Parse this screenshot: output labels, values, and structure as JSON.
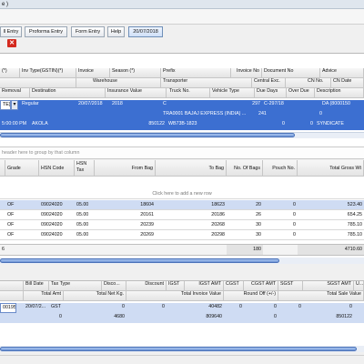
{
  "window": {
    "title": "e )"
  },
  "toolbar": {
    "buttons": [
      "ll Entry",
      "Proforma Entry",
      "Form Entry",
      "Help",
      "20/07/2018"
    ],
    "close_glyph": "✕"
  },
  "top_grid": {
    "header_row1": [
      "(*)",
      "Inv Type(GSTIN)(*)",
      "Invoice",
      "Season (*)",
      "Prefix",
      "Invoice No",
      "Document No",
      "Advice"
    ],
    "header_row2": [
      "Warehouse",
      "Transporter",
      "Central Exc.",
      "CN No.",
      "CN Date"
    ],
    "header_row3": [
      "Removal",
      "Destination",
      "Insurance Value",
      "Truck No.",
      "Vehicle Type",
      "Due Days",
      "Over Due",
      "Description"
    ],
    "row1": {
      "c0": "TE)",
      "dropdown": "▾",
      "regular": "Regular",
      "date": "20/07/2018",
      "year": "2018",
      "c": "C",
      "n297": "297",
      "cno": "C-297/18",
      "da": "DA (8000150"
    },
    "row2": {
      "transporter": "TRA0001 BAJAJ EXPRESS (INDIA) ...",
      "n241": "241",
      "val": "0"
    },
    "row3": {
      "time": "5:00:00 PM",
      "dest": "AKOLA",
      "ins": "850122",
      "truck": "WB73B-1823",
      "d1": "0",
      "d2": "0",
      "desc": "SYNDICATE"
    }
  },
  "group_hint": "header here to group by that column",
  "item_grid": {
    "headers": [
      "Grade",
      "HSN Code",
      "HSN Tax",
      "From Bag",
      "To Bag",
      "No. Of Bags",
      "Pouch No.",
      "Total Gross Wt"
    ],
    "add_row": "Click here to add a new row",
    "rows": [
      {
        "grade": "OF",
        "hsn": "09024020",
        "tax": "05.00",
        "from": "18604",
        "to": "18623",
        "bags": "20",
        "pouch": "0",
        "gross": "523.40"
      },
      {
        "grade": "OF",
        "hsn": "09024020",
        "tax": "05.00",
        "from": "20161",
        "to": "20186",
        "bags": "26",
        "pouch": "0",
        "gross": "654.25"
      },
      {
        "grade": "OF",
        "hsn": "09024020",
        "tax": "05.00",
        "from": "20239",
        "to": "20268",
        "bags": "30",
        "pouch": "0",
        "gross": "785.10"
      },
      {
        "grade": "OF",
        "hsn": "09024020",
        "tax": "05.00",
        "from": "20269",
        "to": "20298",
        "bags": "30",
        "pouch": "0",
        "gross": "785.10"
      }
    ],
    "totals": {
      "left": "6",
      "bags": "180",
      "gross": "4710.60"
    }
  },
  "bottom_grid": {
    "header_row1": [
      "Bill Date",
      "Tax Type",
      "Disco...",
      "Discount",
      "IGST",
      "IGST AMT",
      "CGST",
      "CGST AMT",
      "SGST",
      "SGST AMT",
      "U..."
    ],
    "header_row2": [
      "Total Amt",
      "Total Net Kg.",
      "Total Invoice Value",
      "Round Off (+/-)",
      "Total Sale Value"
    ],
    "row1": {
      "id": "00195",
      "date": "20/07/2...",
      "tax": "GST",
      "d1": "0",
      "d2": "0",
      "igst_amt": "40482",
      "c1": "0",
      "c2": "0",
      "c3": "0",
      "c4": "0"
    },
    "row2": {
      "total": "0",
      "kg": "4680",
      "inv": "809640",
      "round": "0",
      "sale": "850122"
    }
  }
}
